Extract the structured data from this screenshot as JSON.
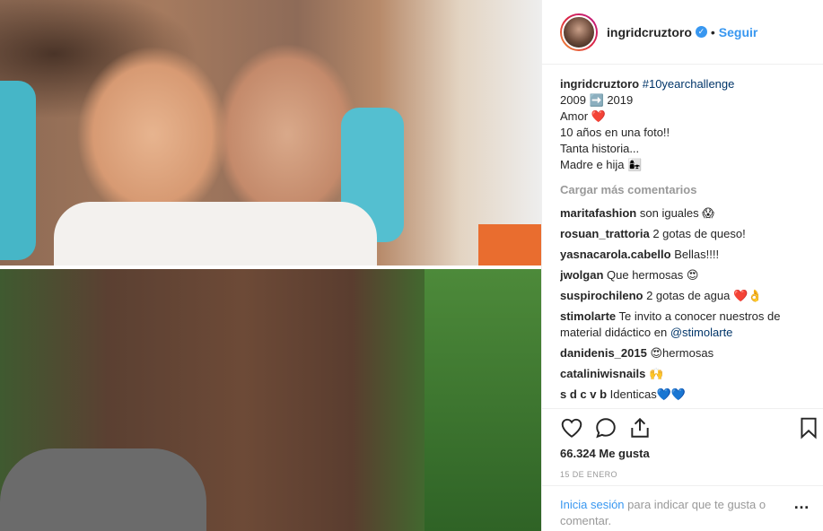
{
  "post": {
    "username": "ingridcruztoro",
    "follow_label": "Seguir",
    "hashtag": "#10yearchallenge",
    "caption_lines": [
      "2009 ➡️ 2019",
      "Amor ❤️",
      "10 años en una foto!!",
      "Tanta historia...",
      "Madre e hija 👩‍👧"
    ],
    "load_more": "Cargar más comentarios",
    "likes": "66.324 Me gusta",
    "date": "15 DE ENERO"
  },
  "comments": [
    {
      "user": "maritafashion",
      "text": "son iguales 😱"
    },
    {
      "user": "rosuan_trattoria",
      "text": "2 gotas de queso!"
    },
    {
      "user": "yasnacarola.cabello",
      "text": "Bellas!!!!"
    },
    {
      "user": "jwolgan",
      "text": "Que hermosas 😍"
    },
    {
      "user": "suspirochileno",
      "text": "2 gotas de agua ❤️👌"
    },
    {
      "user": "stimolarte",
      "text": "Te invito a conocer nuestros de material didáctico en",
      "mention": "@stimolarte"
    },
    {
      "user": "danidenis_2015",
      "text": "😍hermosas"
    },
    {
      "user": "cataliniwisnails",
      "text": "🙌"
    },
    {
      "user": "s d c v b",
      "text": "Identicas💙💙"
    }
  ],
  "login_bar": {
    "link": "Inicia sesión",
    "text": "para indicar que te gusta o comentar."
  },
  "colors": {
    "link": "#3897f0",
    "muted": "#999999",
    "heart": "#ed4956"
  }
}
